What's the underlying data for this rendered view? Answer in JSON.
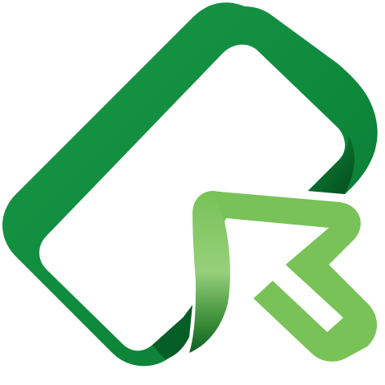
{
  "logo": {
    "icon": "card-with-arrow-cursor-icon",
    "colors": {
      "background": "#ffffff",
      "card_dark_green": "#0f8a3c",
      "card_deep_green": "#045a23",
      "arrow_light_green": "#78c257",
      "arrow_highlight": "#9bd27e",
      "arrow_shadow": "#0d6b2a"
    }
  }
}
